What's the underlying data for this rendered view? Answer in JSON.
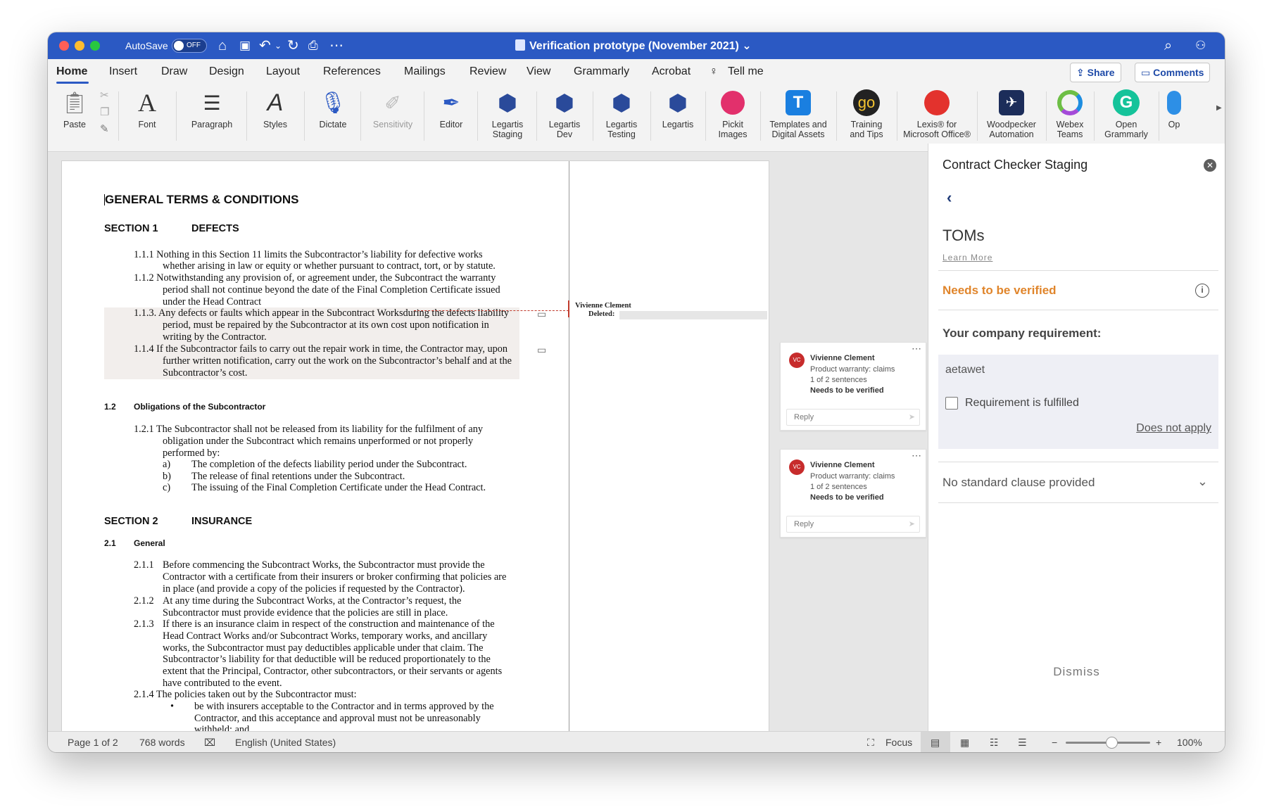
{
  "titlebar": {
    "autosave_label": "AutoSave",
    "autosave_state": "OFF",
    "document_title": "Verification prototype (November 2021) ⌄"
  },
  "menu": {
    "tabs": [
      "Home",
      "Insert",
      "Draw",
      "Design",
      "Layout",
      "References",
      "Mailings",
      "Review",
      "View",
      "Grammarly",
      "Acrobat",
      "Tell me"
    ],
    "share": "Share",
    "comments": "Comments"
  },
  "ribbon": {
    "paste": "Paste",
    "font": "Font",
    "paragraph": "Paragraph",
    "styles": "Styles",
    "dictate": "Dictate",
    "sensitivity": "Sensitivity",
    "editor": "Editor",
    "legartis_staging": [
      "Legartis",
      "Staging"
    ],
    "legartis_dev": [
      "Legartis",
      "Dev"
    ],
    "legartis_testing": [
      "Legartis",
      "Testing"
    ],
    "legartis": "Legartis",
    "pickit": [
      "Pickit",
      "Images"
    ],
    "templates": [
      "Templates and",
      "Digital Assets"
    ],
    "training": [
      "Training",
      "and Tips"
    ],
    "lexis": [
      "Lexis® for",
      "Microsoft Office®"
    ],
    "woodpecker": [
      "Woodpecker",
      "Automation"
    ],
    "webex": [
      "Webex",
      "Teams"
    ],
    "grammarly": [
      "Open",
      "Grammarly"
    ],
    "more": "Op"
  },
  "document": {
    "title": "GENERAL TERMS & CONDITIONS",
    "s1_num": "SECTION 1",
    "s1_name": "DEFECTS",
    "p111a": "1.1.1 Nothing in this Section 11 limits the Subcontractor’s liability for defective works",
    "p111b": "whether arising in law or equity or whether pursuant to contract, tort, or by statute.",
    "p112a": "1.1.2 Notwithstanding any provision of, or agreement under, the Subcontract the warranty",
    "p112b": "period shall not continue beyond the date of the Final Completion Certificate issued",
    "p112c": "under the Head Contract",
    "p113a": "1.1.3. Any defects or faults which appear in the Subcontract Worksduring the defects liability",
    "p113b": "period, must be repaired by the Subcontractor at its own cost upon notification in",
    "p113c": "writing by the Contractor.",
    "p114a": "1.1.4 If the Subcontractor fails to carry out the repair work in time, the Contractor may, upon",
    "p114b": "further written notification, carry out the work on the Subcontractor’s behalf and at the",
    "p114c": "Subcontractor’s cost.",
    "h12_num": "1.2",
    "h12": "Obligations of the Subcontractor",
    "p121a": "1.2.1 The Subcontractor shall not be released from its liability for the fulfilment of any",
    "p121b": "obligation under the Subcontract which remains unperformed or not properly",
    "p121c": "performed by:",
    "la": "a)",
    "la_t": "The completion of the defects liability period under the Subcontract.",
    "lb": "b)",
    "lb_t": "The release of final retentions under the Subcontract.",
    "lc": "c)",
    "lc_t": "The issuing of the Final Completion Certificate under the Head Contract.",
    "s2_num": "SECTION 2",
    "s2_name": "INSURANCE",
    "h21_num": "2.1",
    "h21": "General",
    "n211": "2.1.1",
    "p211a": "Before commencing the Subcontract Works, the Subcontractor must provide the",
    "p211b": "Contractor with a certificate from their insurers or broker confirming that policies are",
    "p211c": "in place (and provide a copy of the policies if requested by the Contractor).",
    "n212": "2.1.2",
    "p212a": "At any time during the Subcontract Works, at the Contractor’s request, the",
    "p212b": "Subcontractor must provide evidence that the policies are still in place.",
    "n213": "2.1.3",
    "p213a": "If there is an insurance claim in respect of the construction and maintenance of the",
    "p213b": "Head Contract Works and/or Subcontract Works, temporary works, and ancillary",
    "p213c": "works, the Subcontractor must pay deductibles applicable under that claim. The",
    "p213d": "Subcontractor’s liability for that deductible will be reduced proportionately to the",
    "p213e": "extent that the Principal, Contractor, other subcontractors, or their servants or agents",
    "p213f": "have contributed to the event.",
    "p214": "2.1.4 The policies taken out by the Subcontractor must:",
    "bullet": "•",
    "p214a": "be with insurers acceptable to the Contractor and in terms approved by the",
    "p214b": "Contractor, and this acceptance and approval must not be unreasonably",
    "p214c": "withheld; and",
    "markup_author": "Vivienne Clement",
    "markup_deleted": "Deleted:"
  },
  "comments": [
    {
      "initials": "VC",
      "author": "Vivienne Clement",
      "line1": "Product warranty: claims",
      "line2": "1 of 2 sentences",
      "status": "Needs to be verified",
      "reply": "Reply"
    },
    {
      "initials": "VC",
      "author": "Vivienne Clement",
      "line1": "Product warranty: claims",
      "line2": "1 of 2 sentences",
      "status": "Needs to be verified",
      "reply": "Reply"
    }
  ],
  "panel": {
    "title": "Contract Checker Staging",
    "heading": "TOMs",
    "learn_more": "Learn More",
    "status": "Needs to be verified",
    "requirement_title": "Your company requirement:",
    "requirement_value": "aetawet",
    "fulfilled_label": "Requirement is fulfilled",
    "does_not_apply": "Does not apply",
    "no_standard": "No standard clause provided",
    "dismiss": "Dismiss",
    "status_color": "#e0852b"
  },
  "statusbar": {
    "page": "Page 1 of 2",
    "words": "768 words",
    "language": "English (United States)",
    "focus": "Focus",
    "zoom": "100%",
    "zoom_minus": "−",
    "zoom_plus": "+"
  },
  "colors": {
    "titlebar": "#2b59c3",
    "accent": "#1e4aa8"
  }
}
